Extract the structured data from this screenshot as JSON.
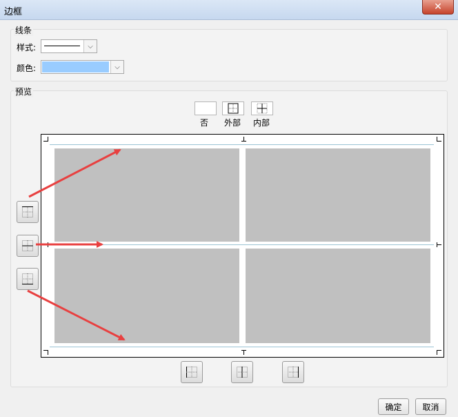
{
  "window": {
    "title": "边框",
    "close_glyph": "✕"
  },
  "line_group": {
    "label": "线条",
    "style_label": "样式:",
    "color_label": "颜色:",
    "color_value": "#99ccff",
    "arrow_glyph": "⌵"
  },
  "preview_group": {
    "label": "预览",
    "presets": [
      {
        "label": "否",
        "icon": "no-border-icon"
      },
      {
        "label": "外部",
        "icon": "outer-border-icon"
      },
      {
        "label": "内部",
        "icon": "inner-border-icon"
      }
    ],
    "side_buttons": [
      "top-border-icon",
      "middle-horizontal-border-icon",
      "bottom-border-icon"
    ],
    "bottom_buttons": [
      "left-border-icon",
      "middle-vertical-border-icon",
      "right-border-icon"
    ]
  },
  "footer": {
    "ok_label": "确定",
    "cancel_label": "取消"
  },
  "colors": {
    "annotation_arrow": "#e84040",
    "cell_fill": "#c0c0c0",
    "guide_line": "#9ac3d4"
  }
}
